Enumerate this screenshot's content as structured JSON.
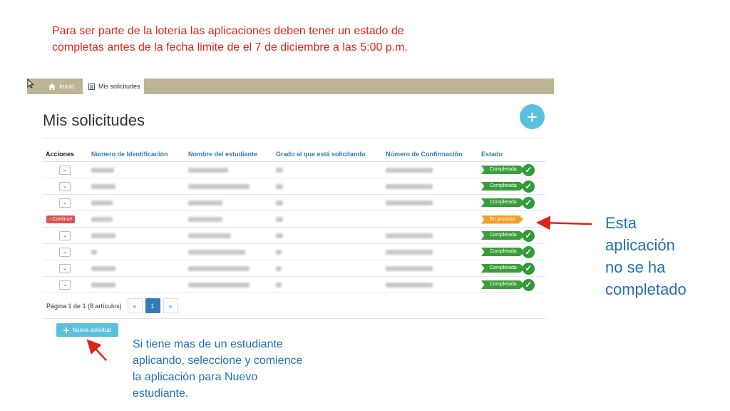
{
  "notes": {
    "top_lines": [
      "Para ser parte de la lotería las aplicaciones deben tener un estado de",
      "completas antes de la fecha limite de el 7 de diciembre a las 5:00 p.m."
    ],
    "right_lines": [
      "Esta",
      "aplicación",
      "no se ha",
      "completado"
    ],
    "bottom_lines": [
      "Si tiene mas de un estudiante",
      "aplicando, seleccione y comience",
      "la aplicación para Nuevo",
      "estudiante."
    ]
  },
  "tabs": {
    "home": "Inicio",
    "active": "Mis solicitudes"
  },
  "page": {
    "title": "Mis solicitudes",
    "add_symbol": "+"
  },
  "table": {
    "headers": [
      "Acciones",
      "Número de Identificación",
      "Nombre del estudiante",
      "Grado al que está solicitando",
      "Número de Confirmación",
      "Estado"
    ],
    "continue_label": "Continue",
    "rows": [
      {
        "status": "Completada",
        "complete": true
      },
      {
        "status": "Completada",
        "complete": true
      },
      {
        "status": "Completada",
        "complete": true
      },
      {
        "status": "En proceso",
        "complete": false
      },
      {
        "status": "Completada",
        "complete": true
      },
      {
        "status": "Completada",
        "complete": true
      },
      {
        "status": "Completada",
        "complete": true
      },
      {
        "status": "Completada",
        "complete": true
      }
    ]
  },
  "pager": {
    "info": "Página 1 de 1 (8 artículos)",
    "prev": "«",
    "page": "1",
    "next": "»"
  },
  "new_button": "Nueva solicitud",
  "colors": {
    "note_red": "#e0231c",
    "note_blue": "#1f6fb5",
    "tabbar": "#bdb496",
    "accent": "#5bc0de",
    "complete": "#3a9d3a",
    "in_progress": "#f0a028"
  }
}
